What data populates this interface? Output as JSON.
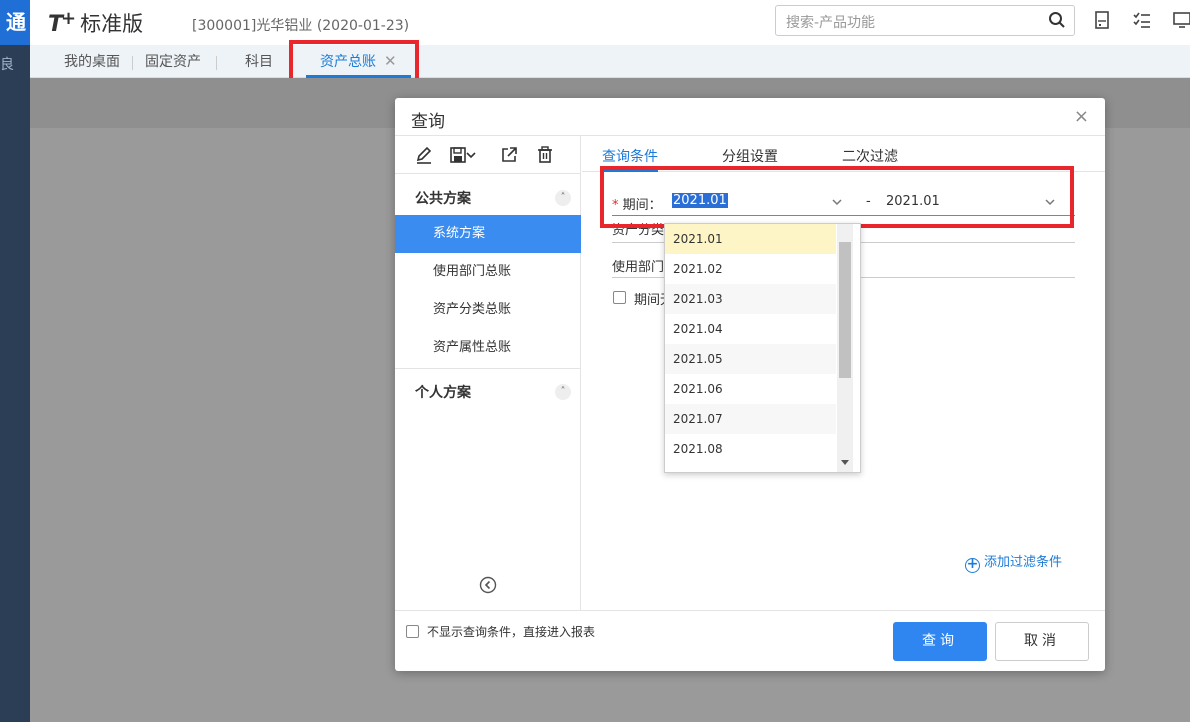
{
  "rail": {
    "logo_text": "通",
    "icon_text": "良"
  },
  "header": {
    "brand": "T",
    "brand_plus": "+",
    "brand_name": "标准版",
    "company": "[300001]光华铝业   (2020-01-23)",
    "search_placeholder": "搜索-产品功能"
  },
  "tabs": [
    {
      "label": "我的桌面"
    },
    {
      "label": "固定资产"
    },
    {
      "label": "科目"
    },
    {
      "label": "资产总账",
      "close": "✕"
    }
  ],
  "dialog": {
    "title": "查询",
    "close": "×",
    "sections": {
      "public": {
        "label": "公共方案",
        "toggle": "˄"
      },
      "personal": {
        "label": "个人方案",
        "toggle": "˄"
      }
    },
    "schemes": [
      "系统方案",
      "使用部门总账",
      "资产分类总账",
      "资产属性总账"
    ],
    "right_tabs": [
      "查询条件",
      "分组设置",
      "二次过滤"
    ],
    "period": {
      "required_mark": "*",
      "label": "期间：",
      "from": "2021.01",
      "dash": "-",
      "to": "2021.01"
    },
    "hidden_rows": [
      {
        "label": "资产分类"
      },
      {
        "label": "使用部门"
      }
    ],
    "checkbox_label": "期间无",
    "add_filter": "添加过滤条件",
    "footer_checkbox": "不显示查询条件，直接进入报表",
    "btn_query": "查询",
    "btn_cancel": "取消"
  },
  "dropdown": {
    "options": [
      "2021.01",
      "2021.02",
      "2021.03",
      "2021.04",
      "2021.05",
      "2021.06",
      "2021.07",
      "2021.08"
    ],
    "selected": "2021.01"
  },
  "colors": {
    "accent": "#1c7bd6",
    "highlight": "#e8262b",
    "selected_scheme": "#3b8cf0"
  }
}
